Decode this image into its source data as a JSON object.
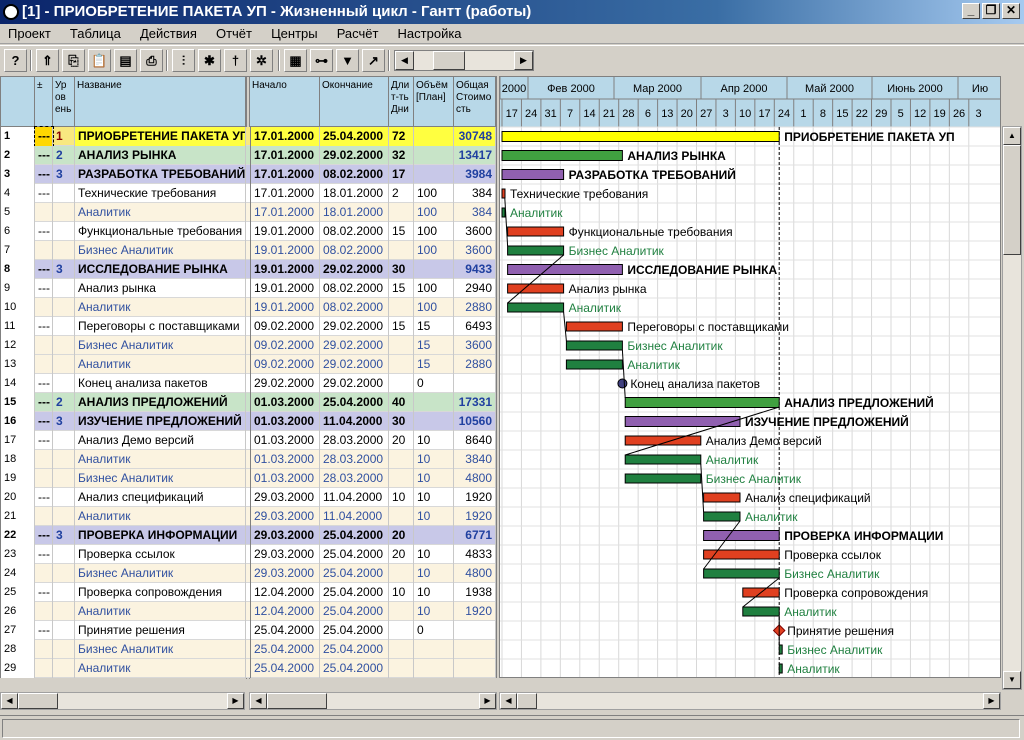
{
  "window": {
    "title": "[1] - ПРИОБРЕТЕНИЕ ПАКЕТА УП - Жизненный цикл - Гантт (работы)"
  },
  "menu": [
    "Проект",
    "Таблица",
    "Действия",
    "Отчёт",
    "Центры",
    "Расчёт",
    "Настройка"
  ],
  "toolbar": [
    {
      "name": "help-button",
      "glyph": "?"
    },
    {
      "name": "level-up-button",
      "glyph": "⇑"
    },
    {
      "name": "copy-button",
      "glyph": "⎘"
    },
    {
      "name": "paste-button",
      "glyph": "📋"
    },
    {
      "name": "save-all-button",
      "glyph": "▤"
    },
    {
      "name": "print-button",
      "glyph": "⎙"
    },
    {
      "name": "filter-button",
      "glyph": "⫶"
    },
    {
      "name": "resource-button",
      "glyph": "✱"
    },
    {
      "name": "person-button",
      "glyph": "†"
    },
    {
      "name": "spider-button",
      "glyph": "✲"
    },
    {
      "name": "gantt-view-button",
      "glyph": "▦"
    },
    {
      "name": "network-button",
      "glyph": "⊶"
    },
    {
      "name": "critical-path-button",
      "glyph": "▼"
    },
    {
      "name": "chart-button",
      "glyph": "↗"
    }
  ],
  "columns": {
    "num": "",
    "pm": "±",
    "level": "Ур ов ень",
    "name": "Название",
    "start": "Начало",
    "end": "Окончание",
    "dur": "Дли т-ть Дни",
    "vol": "Объём [План]",
    "cost": "Общая Стоимо сть"
  },
  "timeline": {
    "months": [
      "2000",
      "Фев 2000",
      "Мар 2000",
      "Апр 2000",
      "Май 2000",
      "Июнь 2000",
      "Ию"
    ],
    "days": [
      "17",
      "24",
      "31",
      "7",
      "14",
      "21",
      "28",
      "6",
      "13",
      "20",
      "27",
      "3",
      "10",
      "17",
      "24",
      "1",
      "8",
      "15",
      "22",
      "29",
      "5",
      "12",
      "19",
      "26",
      "3"
    ]
  },
  "colors": {
    "yellow": "#ffff00",
    "green": "#40a040",
    "purple": "#9060b0",
    "red": "#e04020",
    "darkgreen": "#208040",
    "summaryRowL1": "#f8e880",
    "summaryRowL2": "#c8e4c8",
    "summaryRowL3": "#c8c8e8",
    "resourceRow": "#fbf3e0"
  },
  "rows": [
    {
      "n": "1",
      "pm": "---",
      "lvl": "1",
      "name": "ПРИОБРЕТЕНИЕ ПАКЕТА УП",
      "start": "17.01.2000",
      "end": "25.04.2000",
      "dur": "72",
      "vol": "",
      "cost": "30748",
      "type": "s1",
      "s": 0,
      "e": 99,
      "label": "ПРИОБРЕТЕНИЕ ПАКЕТА УП"
    },
    {
      "n": "2",
      "pm": "---",
      "lvl": "2",
      "name": "АНАЛИЗ РЫНКА",
      "start": "17.01.2000",
      "end": "29.02.2000",
      "dur": "32",
      "vol": "",
      "cost": "13417",
      "type": "s2",
      "s": 0,
      "e": 43,
      "label": "АНАЛИЗ РЫНКА"
    },
    {
      "n": "3",
      "pm": "---",
      "lvl": "3",
      "name": "РАЗРАБОТКА ТРЕБОВАНИЙ",
      "start": "17.01.2000",
      "end": "08.02.2000",
      "dur": "17",
      "vol": "",
      "cost": "3984",
      "type": "s3",
      "s": 0,
      "e": 22,
      "label": "РАЗРАБОТКА ТРЕБОВАНИЙ"
    },
    {
      "n": "4",
      "pm": "---",
      "lvl": "",
      "name": "Технические требования",
      "start": "17.01.2000",
      "end": "18.01.2000",
      "dur": "2",
      "vol": "100",
      "cost": "384",
      "type": "t",
      "s": 0,
      "e": 1,
      "label": "Технические требования"
    },
    {
      "n": "5",
      "pm": "",
      "lvl": "",
      "name": "Аналитик",
      "start": "17.01.2000",
      "end": "18.01.2000",
      "dur": "",
      "vol": "100",
      "cost": "384",
      "type": "r",
      "s": 0,
      "e": 1,
      "label": "Аналитик"
    },
    {
      "n": "6",
      "pm": "---",
      "lvl": "",
      "name": "Функциональные требования",
      "start": "19.01.2000",
      "end": "08.02.2000",
      "dur": "15",
      "vol": "100",
      "cost": "3600",
      "type": "t",
      "s": 2,
      "e": 22,
      "label": "Функциональные требования"
    },
    {
      "n": "7",
      "pm": "",
      "lvl": "",
      "name": "Бизнес Аналитик",
      "start": "19.01.2000",
      "end": "08.02.2000",
      "dur": "",
      "vol": "100",
      "cost": "3600",
      "type": "r",
      "s": 2,
      "e": 22,
      "label": "Бизнес Аналитик"
    },
    {
      "n": "8",
      "pm": "---",
      "lvl": "3",
      "name": "ИССЛЕДОВАНИЕ РЫНКА",
      "start": "19.01.2000",
      "end": "29.02.2000",
      "dur": "30",
      "vol": "",
      "cost": "9433",
      "type": "s3",
      "s": 2,
      "e": 43,
      "label": "ИССЛЕДОВАНИЕ РЫНКА"
    },
    {
      "n": "9",
      "pm": "---",
      "lvl": "",
      "name": "Анализ рынка",
      "start": "19.01.2000",
      "end": "08.02.2000",
      "dur": "15",
      "vol": "100",
      "cost": "2940",
      "type": "t",
      "s": 2,
      "e": 22,
      "label": "Анализ рынка"
    },
    {
      "n": "10",
      "pm": "",
      "lvl": "",
      "name": "Аналитик",
      "start": "19.01.2000",
      "end": "08.02.2000",
      "dur": "",
      "vol": "100",
      "cost": "2880",
      "type": "r",
      "s": 2,
      "e": 22,
      "label": "Аналитик"
    },
    {
      "n": "11",
      "pm": "---",
      "lvl": "",
      "name": "Переговоры с поставщиками",
      "start": "09.02.2000",
      "end": "29.02.2000",
      "dur": "15",
      "vol": "15",
      "cost": "6493",
      "type": "t",
      "s": 23,
      "e": 43,
      "label": "Переговоры с поставщиками"
    },
    {
      "n": "12",
      "pm": "",
      "lvl": "",
      "name": "Бизнес Аналитик",
      "start": "09.02.2000",
      "end": "29.02.2000",
      "dur": "",
      "vol": "15",
      "cost": "3600",
      "type": "r",
      "s": 23,
      "e": 43,
      "label": "Бизнес Аналитик"
    },
    {
      "n": "13",
      "pm": "",
      "lvl": "",
      "name": "Аналитик",
      "start": "09.02.2000",
      "end": "29.02.2000",
      "dur": "",
      "vol": "15",
      "cost": "2880",
      "type": "r",
      "s": 23,
      "e": 43,
      "label": "Аналитик"
    },
    {
      "n": "14",
      "pm": "---",
      "lvl": "",
      "name": "Конец анализа пакетов",
      "start": "29.02.2000",
      "end": "29.02.2000",
      "dur": "",
      "vol": "0",
      "cost": "",
      "type": "m",
      "s": 43,
      "e": 43,
      "label": "Конец анализа пакетов"
    },
    {
      "n": "15",
      "pm": "---",
      "lvl": "2",
      "name": "АНАЛИЗ ПРЕДЛОЖЕНИЙ",
      "start": "01.03.2000",
      "end": "25.04.2000",
      "dur": "40",
      "vol": "",
      "cost": "17331",
      "type": "s2",
      "s": 44,
      "e": 99,
      "label": "АНАЛИЗ ПРЕДЛОЖЕНИЙ"
    },
    {
      "n": "16",
      "pm": "---",
      "lvl": "3",
      "name": "ИЗУЧЕНИЕ ПРЕДЛОЖЕНИЙ",
      "start": "01.03.2000",
      "end": "11.04.2000",
      "dur": "30",
      "vol": "",
      "cost": "10560",
      "type": "s3",
      "s": 44,
      "e": 85,
      "label": "ИЗУЧЕНИЕ ПРЕДЛОЖЕНИЙ"
    },
    {
      "n": "17",
      "pm": "---",
      "lvl": "",
      "name": "Анализ Демо версий",
      "start": "01.03.2000",
      "end": "28.03.2000",
      "dur": "20",
      "vol": "10",
      "cost": "8640",
      "type": "t",
      "s": 44,
      "e": 71,
      "label": "Анализ Демо версий"
    },
    {
      "n": "18",
      "pm": "",
      "lvl": "",
      "name": "Аналитик",
      "start": "01.03.2000",
      "end": "28.03.2000",
      "dur": "",
      "vol": "10",
      "cost": "3840",
      "type": "r",
      "s": 44,
      "e": 71,
      "label": "Аналитик"
    },
    {
      "n": "19",
      "pm": "",
      "lvl": "",
      "name": "Бизнес Аналитик",
      "start": "01.03.2000",
      "end": "28.03.2000",
      "dur": "",
      "vol": "10",
      "cost": "4800",
      "type": "r",
      "s": 44,
      "e": 71,
      "label": "Бизнес Аналитик"
    },
    {
      "n": "20",
      "pm": "---",
      "lvl": "",
      "name": "Анализ спецификаций",
      "start": "29.03.2000",
      "end": "11.04.2000",
      "dur": "10",
      "vol": "10",
      "cost": "1920",
      "type": "t",
      "s": 72,
      "e": 85,
      "label": "Анализ спецификаций"
    },
    {
      "n": "21",
      "pm": "",
      "lvl": "",
      "name": "Аналитик",
      "start": "29.03.2000",
      "end": "11.04.2000",
      "dur": "",
      "vol": "10",
      "cost": "1920",
      "type": "r",
      "s": 72,
      "e": 85,
      "label": "Аналитик"
    },
    {
      "n": "22",
      "pm": "---",
      "lvl": "3",
      "name": "ПРОВЕРКА ИНФОРМАЦИИ",
      "start": "29.03.2000",
      "end": "25.04.2000",
      "dur": "20",
      "vol": "",
      "cost": "6771",
      "type": "s3",
      "s": 72,
      "e": 99,
      "label": "ПРОВЕРКА ИНФОРМАЦИИ"
    },
    {
      "n": "23",
      "pm": "---",
      "lvl": "",
      "name": "Проверка ссылок",
      "start": "29.03.2000",
      "end": "25.04.2000",
      "dur": "20",
      "vol": "10",
      "cost": "4833",
      "type": "t",
      "s": 72,
      "e": 99,
      "label": "Проверка ссылок"
    },
    {
      "n": "24",
      "pm": "",
      "lvl": "",
      "name": "Бизнес Аналитик",
      "start": "29.03.2000",
      "end": "25.04.2000",
      "dur": "",
      "vol": "10",
      "cost": "4800",
      "type": "r",
      "s": 72,
      "e": 99,
      "label": "Бизнес Аналитик"
    },
    {
      "n": "25",
      "pm": "---",
      "lvl": "",
      "name": "Проверка сопровождения",
      "start": "12.04.2000",
      "end": "25.04.2000",
      "dur": "10",
      "vol": "10",
      "cost": "1938",
      "type": "t",
      "s": 86,
      "e": 99,
      "label": "Проверка сопровождения"
    },
    {
      "n": "26",
      "pm": "",
      "lvl": "",
      "name": "Аналитик",
      "start": "12.04.2000",
      "end": "25.04.2000",
      "dur": "",
      "vol": "10",
      "cost": "1920",
      "type": "r",
      "s": 86,
      "e": 99,
      "label": "Аналитик"
    },
    {
      "n": "27",
      "pm": "---",
      "lvl": "",
      "name": "Принятие решения",
      "start": "25.04.2000",
      "end": "25.04.2000",
      "dur": "",
      "vol": "0",
      "cost": "",
      "type": "md",
      "s": 99,
      "e": 99,
      "label": "Принятие решения"
    },
    {
      "n": "28",
      "pm": "",
      "lvl": "",
      "name": "Бизнес Аналитик",
      "start": "25.04.2000",
      "end": "25.04.2000",
      "dur": "",
      "vol": "",
      "cost": "",
      "type": "r",
      "s": 99,
      "e": 100,
      "label": "Бизнес Аналитик"
    },
    {
      "n": "29",
      "pm": "",
      "lvl": "",
      "name": "Аналитик",
      "start": "25.04.2000",
      "end": "25.04.2000",
      "dur": "",
      "vol": "",
      "cost": "",
      "type": "r",
      "s": 99,
      "e": 100,
      "label": "Аналитик"
    }
  ]
}
